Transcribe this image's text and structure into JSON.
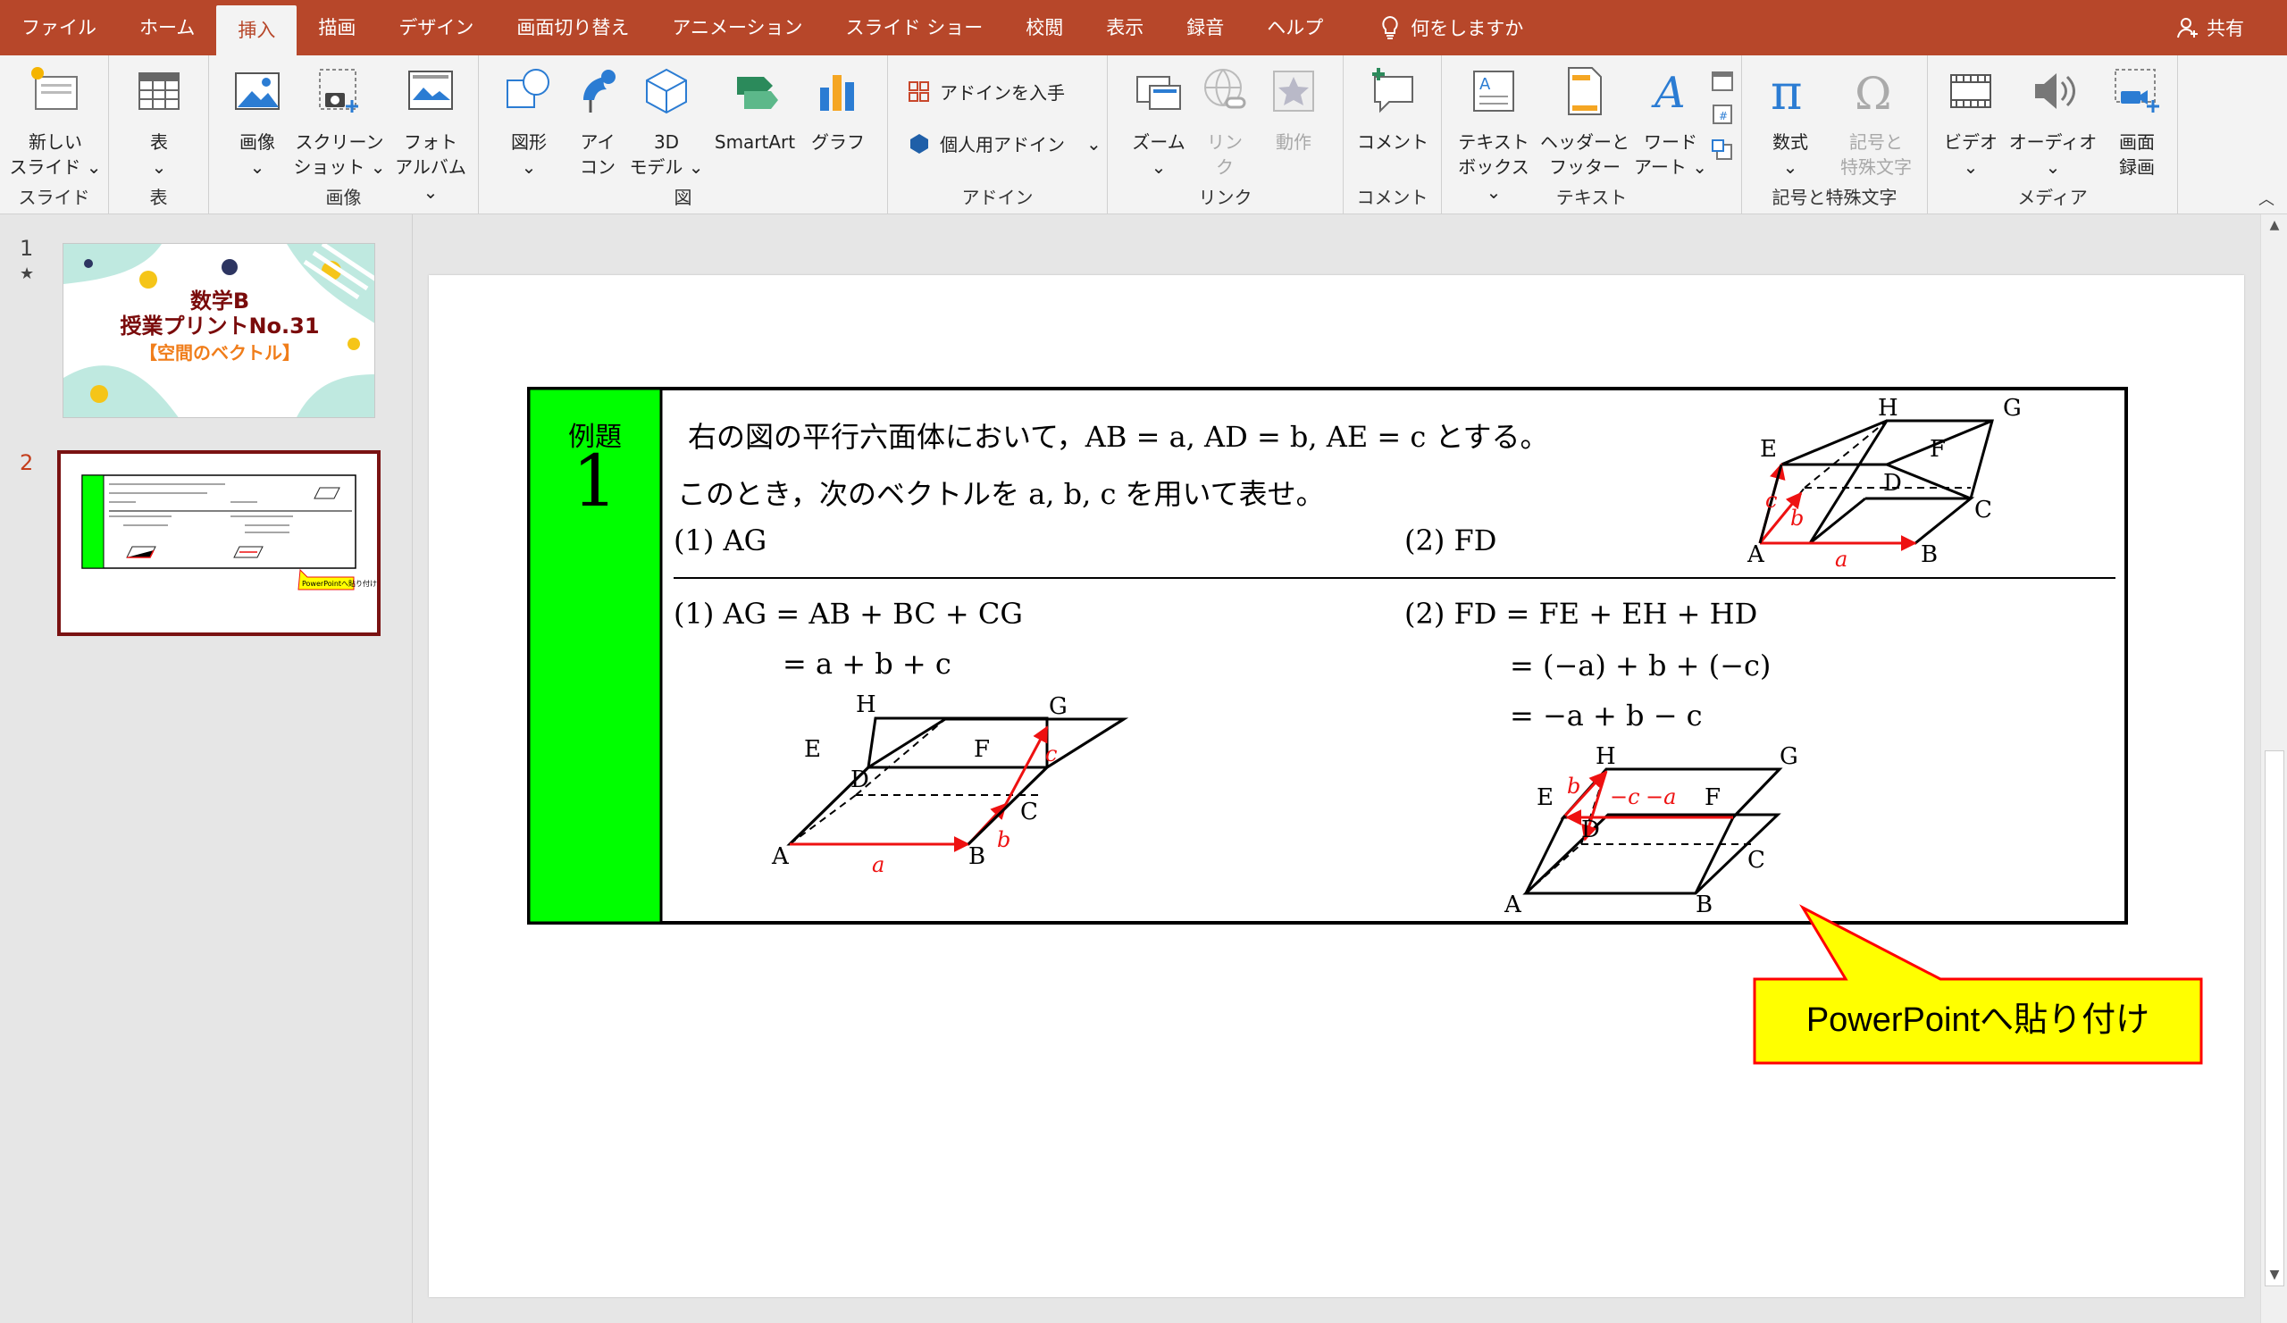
{
  "tabs": [
    "ファイル",
    "ホーム",
    "挿入",
    "描画",
    "デザイン",
    "画面切り替え",
    "アニメーション",
    "スライド ショー",
    "校閲",
    "表示",
    "録音",
    "ヘルプ"
  ],
  "active_tab": "挿入",
  "tell_me": "何をしますか",
  "share": "共有",
  "ribbon": {
    "slides": {
      "new_slide_1": "新しい",
      "new_slide_2": "スライド ⌄",
      "label": "スライド"
    },
    "table": {
      "table": "表",
      "table_arrow": "⌄",
      "label": "表"
    },
    "images": {
      "image": "画像",
      "image_arrow": "⌄",
      "screenshot_1": "スクリーン",
      "screenshot_2": "ショット ⌄",
      "photo_1": "フォト",
      "photo_2": "アルバム ⌄",
      "label": "画像"
    },
    "illustrations": {
      "shapes": "図形",
      "shapes_arrow": "⌄",
      "icons_1": "アイ",
      "icons_2": "コン",
      "model_1": "3D",
      "model_2": "モデル ⌄",
      "smartart": "SmartArt",
      "chart": "グラフ",
      "label": "図"
    },
    "addins": {
      "get": "アドインを入手",
      "personal": "個人用アドイン",
      "personal_arrow": "⌄",
      "label": "アドイン"
    },
    "links": {
      "zoom": "ズーム",
      "zoom_arrow": "⌄",
      "link_1": "リン",
      "link_2": "ク",
      "action": "動作",
      "label": "リンク"
    },
    "comments": {
      "comment": "コメント",
      "label": "コメント"
    },
    "text": {
      "textbox_1": "テキスト",
      "textbox_2": "ボックス ⌄",
      "header_1": "ヘッダーと",
      "header_2": "フッター",
      "wordart_1": "ワード",
      "wordart_2": "アート ⌄",
      "label": "テキスト"
    },
    "symbols": {
      "equation": "数式",
      "equation_arrow": "⌄",
      "symbol_1": "記号と",
      "symbol_2": "特殊文字",
      "label": "記号と特殊文字"
    },
    "media": {
      "video": "ビデオ",
      "video_arrow": "⌄",
      "audio": "オーディオ",
      "audio_arrow": "⌄",
      "screen_1": "画面",
      "screen_2": "録画",
      "label": "メディア"
    }
  },
  "thumbnails": [
    {
      "num": "1",
      "star": "★",
      "title1": "数学B",
      "title2": "授業プリントNo.31",
      "title3": "【空間のベクトル】"
    },
    {
      "num": "2",
      "callout": "PowerPointへ貼り付け"
    }
  ],
  "example": {
    "label": "例題",
    "number": "1",
    "problem_line1": "右の図の平行六面体において，AB = a, AD = b, AE = c とする。",
    "problem_line2": "このとき，次のベクトルを a, b, c を用いて表せ。",
    "q1": "(1)  AG",
    "q2": "(2)  FD",
    "a1_line1": "(1)  AG = AB + BC + CG",
    "a1_line2": "= a + b + c",
    "a2_line1": "(2)  FD = FE + EH + HD",
    "a2_line2": "= (−a) + b + (−c)",
    "a2_line3": "= −a + b − c",
    "vertices": {
      "A": "A",
      "B": "B",
      "C": "C",
      "D": "D",
      "E": "E",
      "F": "F",
      "G": "G",
      "H": "H"
    },
    "vec": {
      "a": "a",
      "b": "b",
      "c": "c",
      "mc": "−c",
      "ma": "−a"
    }
  },
  "callout": "PowerPointへ貼り付け",
  "colors": {
    "accent": "#b7472a",
    "green": "#00ff00",
    "callout_fill": "#ffff00",
    "callout_border": "#ff0000",
    "vector_red": "#ee1111"
  }
}
